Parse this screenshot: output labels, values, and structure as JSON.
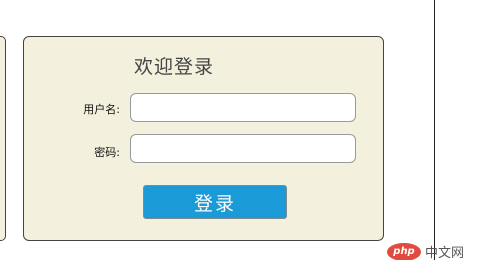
{
  "login": {
    "title": "欢迎登录",
    "username_label": "用户名:",
    "password_label": "密码:",
    "username_value": "",
    "password_value": "",
    "submit_label": "登录"
  },
  "watermark": {
    "logo_text": "php",
    "site_text": "中文网"
  },
  "colors": {
    "panel_bg": "#f3f1de",
    "button_bg": "#1a9ad6",
    "watermark_red": "#e04a3f"
  }
}
